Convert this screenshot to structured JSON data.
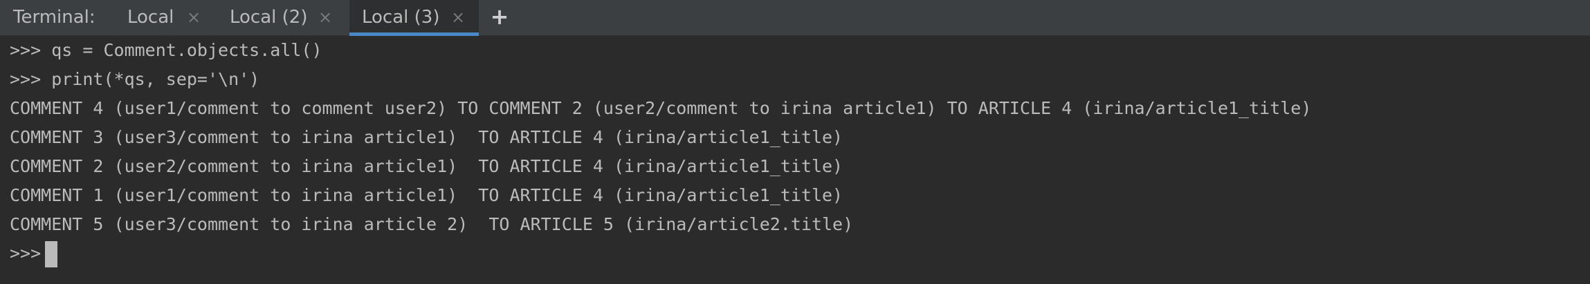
{
  "tabbar": {
    "label": "Terminal:",
    "tabs": [
      {
        "title": "Local",
        "close": "×"
      },
      {
        "title": "Local (2)",
        "close": "×"
      },
      {
        "title": "Local (3)",
        "close": "×"
      }
    ],
    "add_button": "+"
  },
  "console": {
    "lines": [
      ">>> qs = Comment.objects.all()",
      ">>> print(*qs, sep='\\n')",
      "COMMENT 4 (user1/comment to comment user2) TO COMMENT 2 (user2/comment to irina article1) TO ARTICLE 4 (irina/article1_title)",
      "COMMENT 3 (user3/comment to irina article1)  TO ARTICLE 4 (irina/article1_title)",
      "COMMENT 2 (user2/comment to irina article1)  TO ARTICLE 4 (irina/article1_title)",
      "COMMENT 1 (user1/comment to irina article1)  TO ARTICLE 4 (irina/article1_title)",
      "COMMENT 5 (user3/comment to irina article 2)  TO ARTICLE 5 (irina/article2.title)"
    ],
    "prompt": ">>>"
  },
  "colors": {
    "tabbar_bg": "#3c3f41",
    "console_bg": "#2b2b2b",
    "text": "#bbbbbb",
    "active_tab_underline": "#4a88c7"
  }
}
